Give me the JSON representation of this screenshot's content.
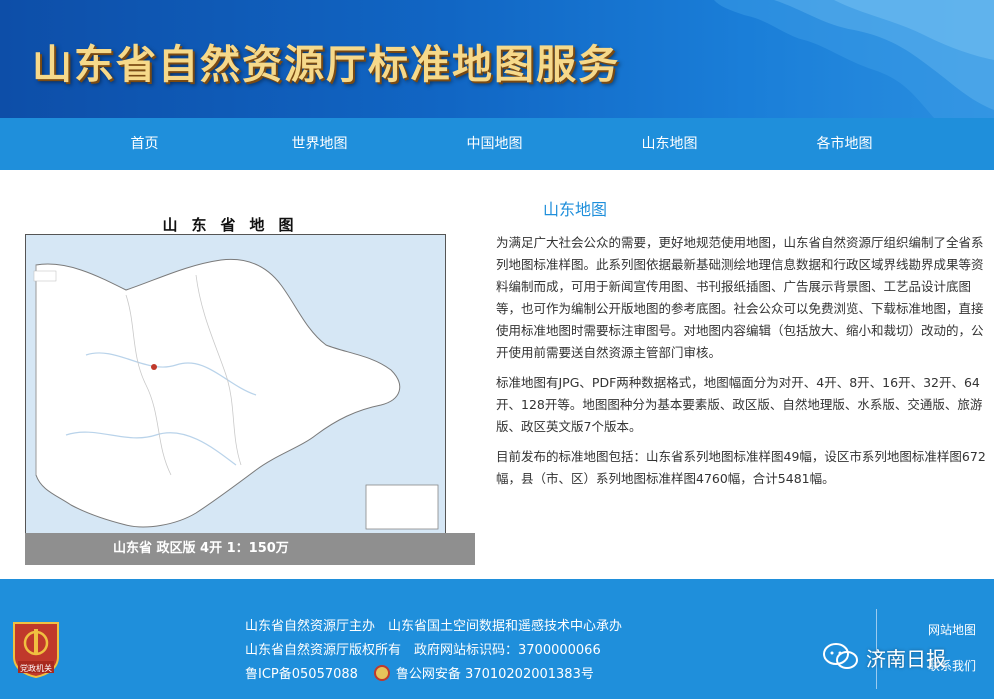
{
  "header": {
    "title": "山东省自然资源厅标准地图服务"
  },
  "nav": {
    "items": [
      {
        "label": "首页"
      },
      {
        "label": "世界地图"
      },
      {
        "label": "中国地图"
      },
      {
        "label": "山东地图"
      },
      {
        "label": "各市地图"
      }
    ]
  },
  "map": {
    "title": "山东省地图",
    "caption": "山东省 政区版 4开 1：150万"
  },
  "content": {
    "title": "山东地图",
    "paragraphs": [
      "为满足广大社会公众的需要，更好地规范使用地图，山东省自然资源厅组织编制了全省系列地图标准样图。此系列图依据最新基础测绘地理信息数据和行政区域界线勘界成果等资料编制而成，可用于新闻宣传用图、书刊报纸插图、广告展示背景图、工艺品设计底图等，也可作为编制公开版地图的参考底图。社会公众可以免费浏览、下载标准地图，直接使用标准地图时需要标注审图号。对地图内容编辑（包括放大、缩小和裁切）改动的，公开使用前需要送自然资源主管部门审核。",
      "标准地图有JPG、PDF两种数据格式，地图幅面分为对开、4开、8开、16开、32开、64开、128开等。地图图种分为基本要素版、政区版、自然地理版、水系版、交通版、旅游版、政区英文版7个版本。",
      "目前发布的标准地图包括：山东省系列地图标准样图49幅，设区市系列地图标准样图672幅，县（市、区）系列地图标准样图4760幅，合计5481幅。"
    ]
  },
  "footer": {
    "badge_label": "党政机关",
    "line1": "山东省自然资源厅主办　山东省国土空间数据和遥感技术中心承办",
    "line2": "山东省自然资源厅版权所有　政府网站标识码：3700000066",
    "icp": "鲁ICP备05057088",
    "police": "鲁公网安备 37010202001383号",
    "sitemap": "网站地图",
    "contact": "联系我们",
    "watermark": "济南日报"
  },
  "colors": {
    "nav": "#1f8fdb",
    "footer": "#1f8fdb",
    "title_gold": "#f6d98a",
    "accent": "#1f8fdb"
  }
}
